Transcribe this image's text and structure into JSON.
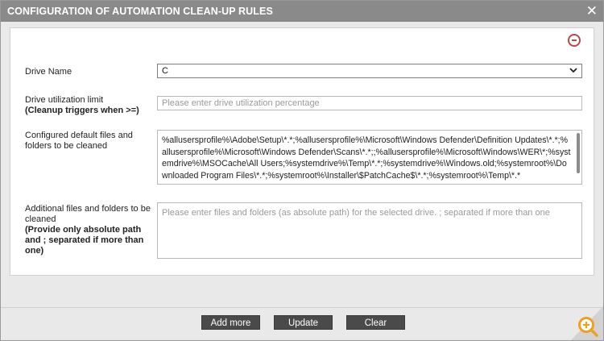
{
  "dialog": {
    "title": "CONFIGURATION OF AUTOMATION CLEAN-UP RULES",
    "close_glyph": "✕"
  },
  "form": {
    "drive_name": {
      "label": "Drive Name",
      "value": "C"
    },
    "utilization": {
      "label": "Drive utilization limit",
      "label_bold": "(Cleanup triggers when >=)",
      "placeholder": "Please enter drive utilization percentage"
    },
    "default_files": {
      "label": "Configured default files and folders to be cleaned",
      "value": "%allusersprofile%\\Adobe\\Setup\\*.*;%allusersprofile%\\Microsoft\\Windows Defender\\Definition Updates\\*.*;%allusersprofile%\\Microsoft\\Windows Defender\\Scans\\*.*;;%allusersprofile%\\Microsoft\\Windows\\WER\\*;%systemdrive%\\MSOCache\\All Users;%systemdrive%\\Temp\\*.*;%systemdrive%\\Windows.old;%systemroot%\\Downloaded Program Files\\*.*;%systemroot%\\Installer\\$PatchCache$\\*.*;%systemroot%\\Temp\\*.*"
    },
    "additional_files": {
      "label": "Additional files and folders to be cleaned",
      "label_bold": "(Provide only absolute path and ; separated if more than one)",
      "placeholder": "Please enter files and folders (as absolute path) for the selected drive. ; separated if more than one"
    }
  },
  "buttons": {
    "add_more": "Add more",
    "update": "Update",
    "clear": "Clear"
  },
  "colors": {
    "titlebar": "#8a8a8a",
    "button": "#4a4a4a",
    "collapse_icon": "#b54a4a",
    "zoom_icon": "#f0a020"
  },
  "icons": {
    "collapse": "minus-circle-icon",
    "dropdown": "chevron-down-icon",
    "zoom": "zoom-in-icon"
  }
}
